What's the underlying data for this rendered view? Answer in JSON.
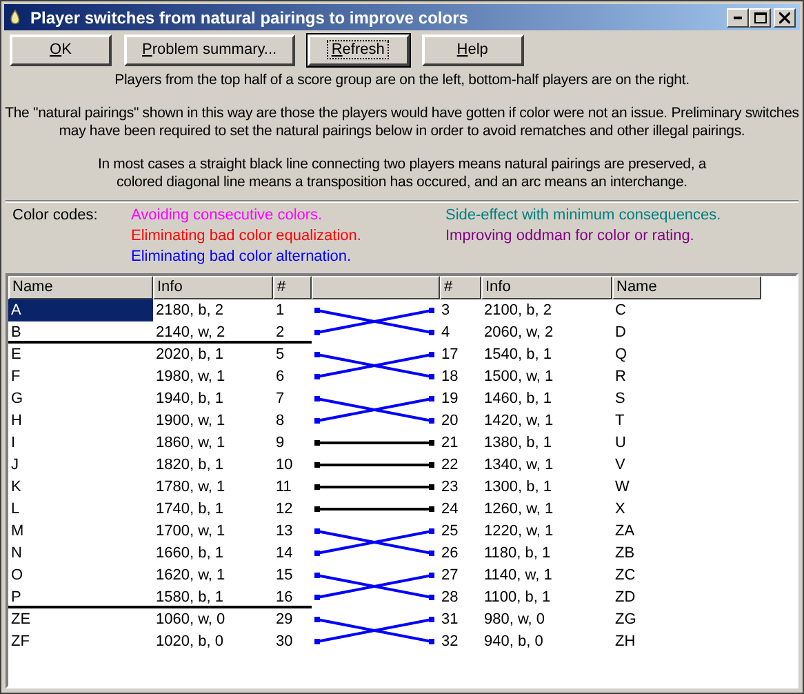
{
  "window": {
    "title": "Player switches from natural pairings to improve colors"
  },
  "buttons": [
    {
      "access_key": "O",
      "label_rest": "K",
      "focused": false
    },
    {
      "access_key": "P",
      "label_rest": "roblem summary...",
      "focused": false
    },
    {
      "access_key": "R",
      "label_rest": "efresh",
      "focused": true
    },
    {
      "access_key": "H",
      "label_rest": "elp",
      "focused": false
    }
  ],
  "description": [
    "Players from the top half of a score group are on the left, bottom-half players are on the right.",
    "The \"natural pairings\" shown in this way are those the players would have gotten if color were not an issue. Preliminary switches may have been required to set the natural pairings below in order to avoid rematches and other illegal pairings.",
    "In most cases a straight black line connecting two players means natural pairings are preserved, a colored diagonal line means a transposition has occured, and an arc means an interchange."
  ],
  "color_codes": {
    "label": "Color codes:",
    "items": [
      {
        "text": "Avoiding consecutive colors.",
        "color": "#ff00ff"
      },
      {
        "text": "Eliminating bad color equalization.",
        "color": "#ff0000"
      },
      {
        "text": "Eliminating bad color alternation.",
        "color": "#0000ff"
      },
      {
        "text": "Side-effect with minimum consequences.",
        "color": "#008080"
      },
      {
        "text": "Improving oddman for color or rating.",
        "color": "#800080"
      }
    ]
  },
  "table": {
    "columns": [
      "Name",
      "Info",
      "#",
      "#",
      "Info",
      "Name"
    ],
    "rows": [
      {
        "left_name": "A",
        "left_info": "2180, b, 2",
        "left_no": "1",
        "right_no": "3",
        "right_info": "2100, b, 2",
        "right_name": "C",
        "kind": "swap",
        "color": "#0000ff",
        "selected": true,
        "group_end": false
      },
      {
        "left_name": "B",
        "left_info": "2140, w, 2",
        "left_no": "2",
        "right_no": "4",
        "right_info": "2060, w, 2",
        "right_name": "D",
        "kind": "swap",
        "color": "#0000ff",
        "selected": false,
        "group_end": true
      },
      {
        "left_name": "E",
        "left_info": "2020, b, 1",
        "left_no": "5",
        "right_no": "17",
        "right_info": "1540, b, 1",
        "right_name": "Q",
        "kind": "swap",
        "color": "#0000ff",
        "selected": false,
        "group_end": false
      },
      {
        "left_name": "F",
        "left_info": "1980, w, 1",
        "left_no": "6",
        "right_no": "18",
        "right_info": "1500, w, 1",
        "right_name": "R",
        "kind": "swap",
        "color": "#0000ff",
        "selected": false,
        "group_end": false
      },
      {
        "left_name": "G",
        "left_info": "1940, b, 1",
        "left_no": "7",
        "right_no": "19",
        "right_info": "1460, b, 1",
        "right_name": "S",
        "kind": "swap",
        "color": "#0000ff",
        "selected": false,
        "group_end": false
      },
      {
        "left_name": "H",
        "left_info": "1900, w, 1",
        "left_no": "8",
        "right_no": "20",
        "right_info": "1420, w, 1",
        "right_name": "T",
        "kind": "swap",
        "color": "#0000ff",
        "selected": false,
        "group_end": false
      },
      {
        "left_name": "I",
        "left_info": "1860, w, 1",
        "left_no": "9",
        "right_no": "21",
        "right_info": "1380, b, 1",
        "right_name": "U",
        "kind": "straight",
        "color": "#000000",
        "selected": false,
        "group_end": false
      },
      {
        "left_name": "J",
        "left_info": "1820, b, 1",
        "left_no": "10",
        "right_no": "22",
        "right_info": "1340, w, 1",
        "right_name": "V",
        "kind": "straight",
        "color": "#000000",
        "selected": false,
        "group_end": false
      },
      {
        "left_name": "K",
        "left_info": "1780, w, 1",
        "left_no": "11",
        "right_no": "23",
        "right_info": "1300, b, 1",
        "right_name": "W",
        "kind": "straight",
        "color": "#000000",
        "selected": false,
        "group_end": false
      },
      {
        "left_name": "L",
        "left_info": "1740, b, 1",
        "left_no": "12",
        "right_no": "24",
        "right_info": "1260, w, 1",
        "right_name": "X",
        "kind": "straight",
        "color": "#000000",
        "selected": false,
        "group_end": false
      },
      {
        "left_name": "M",
        "left_info": "1700, w, 1",
        "left_no": "13",
        "right_no": "25",
        "right_info": "1220, w, 1",
        "right_name": "ZA",
        "kind": "swap",
        "color": "#0000ff",
        "selected": false,
        "group_end": false
      },
      {
        "left_name": "N",
        "left_info": "1660, b, 1",
        "left_no": "14",
        "right_no": "26",
        "right_info": "1180, b, 1",
        "right_name": "ZB",
        "kind": "swap",
        "color": "#0000ff",
        "selected": false,
        "group_end": false
      },
      {
        "left_name": "O",
        "left_info": "1620, w, 1",
        "left_no": "15",
        "right_no": "27",
        "right_info": "1140, w, 1",
        "right_name": "ZC",
        "kind": "swap",
        "color": "#0000ff",
        "selected": false,
        "group_end": false
      },
      {
        "left_name": "P",
        "left_info": "1580, b, 1",
        "left_no": "16",
        "right_no": "28",
        "right_info": "1100, b, 1",
        "right_name": "ZD",
        "kind": "swap",
        "color": "#0000ff",
        "selected": false,
        "group_end": true
      },
      {
        "left_name": "ZE",
        "left_info": "1060, w, 0",
        "left_no": "29",
        "right_no": "31",
        "right_info": "980, w, 0",
        "right_name": "ZG",
        "kind": "swap",
        "color": "#0000ff",
        "selected": false,
        "group_end": false
      },
      {
        "left_name": "ZF",
        "left_info": "1020, b, 0",
        "left_no": "30",
        "right_no": "32",
        "right_info": "940, b, 0",
        "right_name": "ZH",
        "kind": "swap",
        "color": "#0000ff",
        "selected": false,
        "group_end": false
      }
    ]
  }
}
